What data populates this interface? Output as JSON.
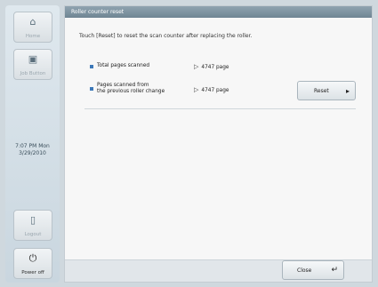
{
  "sidebar": {
    "home_label": "Home",
    "job_button_label": "Job Button",
    "clock_time": "7:07 PM  Mon",
    "clock_date": "3/29/2010",
    "logout_label": "Logout",
    "power_off_label": "Power off"
  },
  "dialog": {
    "title": "Roller counter reset",
    "instruction": "Touch [Reset] to reset the scan counter after replacing the roller.",
    "total_pages_label": "Total pages scanned",
    "total_pages_value": "4747 page",
    "since_roller_label_line1": "Pages scanned from",
    "since_roller_label_line2": "the previous roller change",
    "since_roller_value": "4747 page",
    "reset_label": "Reset",
    "close_label": "Close"
  },
  "colors": {
    "title_bar": "#7f94a2",
    "bullet": "#3c78b8"
  }
}
